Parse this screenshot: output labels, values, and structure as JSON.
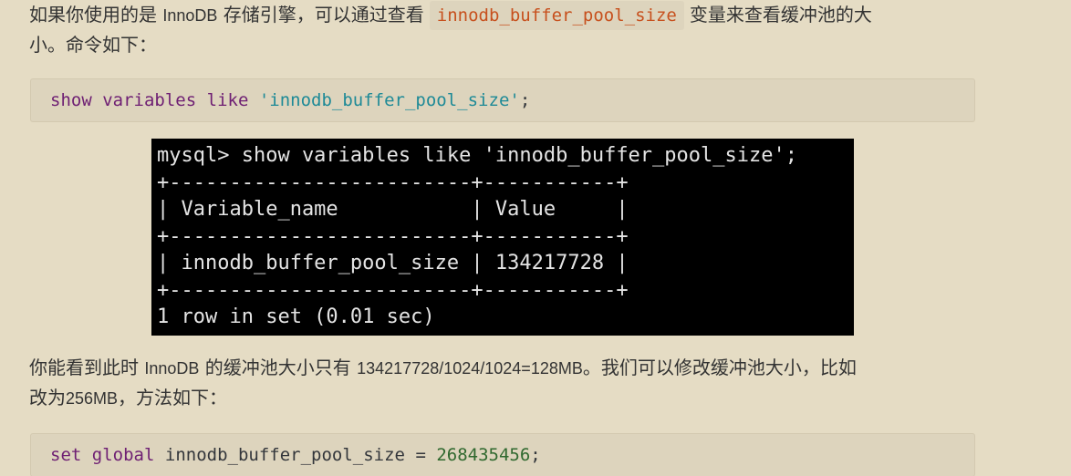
{
  "para1": {
    "t1": "如果你使用的是 ",
    "t2": "InnoDB",
    "t3": " 存储引擎，可以通过查看",
    "code": "innodb_buffer_pool_size",
    "t4": "变量来查看缓冲池的大",
    "t5": "小。命令如下："
  },
  "code1": {
    "kw1": "show",
    "kw2": "variables",
    "kw3": "like",
    "str": "'innodb_buffer_pool_size'",
    "end": ";"
  },
  "terminal": {
    "lines": [
      "mysql> show variables like 'innodb_buffer_pool_size';",
      "+-------------------------+-----------+",
      "| Variable_name           | Value     |",
      "+-------------------------+-----------+",
      "| innodb_buffer_pool_size | 134217728 |",
      "+-------------------------+-----------+",
      "1 row in set (0.01 sec)"
    ]
  },
  "para2": {
    "t1": "你能看到此时 ",
    "t2": "InnoDB",
    "t3": " 的缓冲池大小只有 ",
    "t4": "134217728/1024/1024=128MB",
    "t5": "。我们可以修改缓冲池大小，比如",
    "t6": "改为",
    "t7": "256MB",
    "t8": "，方法如下："
  },
  "code2": {
    "kw1": "set",
    "kw2": "global",
    "var": "innodb_buffer_pool_size",
    "eq": "=",
    "num": "268435456",
    "end": ";"
  }
}
